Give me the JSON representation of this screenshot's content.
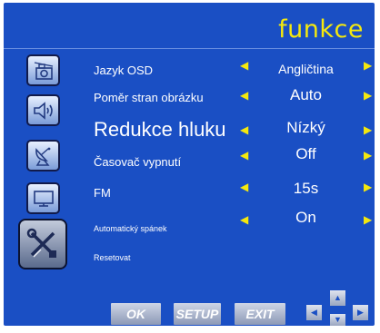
{
  "title": "funkce",
  "menu_rows": [
    {
      "label": "Jazyk OSD",
      "value": "Angličtina"
    },
    {
      "label": "Poměr stran obrázku",
      "value": "Auto"
    },
    {
      "label": "Redukce hluku",
      "value": "Nízký"
    },
    {
      "label": "Časovač vypnutí",
      "value": "Off"
    },
    {
      "label": "FM",
      "value": "15s"
    },
    {
      "label": "Automatický spánek",
      "value": "On"
    },
    {
      "label": "Resetovat",
      "value": ""
    }
  ],
  "sidebar_icons": [
    "picture-icon",
    "sound-icon",
    "channel-icon",
    "screen-icon",
    "function-icon"
  ],
  "buttons": {
    "ok": "OK",
    "setup": "SETUP",
    "exit": "EXIT"
  },
  "arrows": {
    "left": "◀",
    "right": "▶",
    "up": "▲",
    "down": "▼"
  },
  "colors": {
    "background": "#1a4fc4",
    "accent": "#f4e80e",
    "text": "#ffffff"
  }
}
